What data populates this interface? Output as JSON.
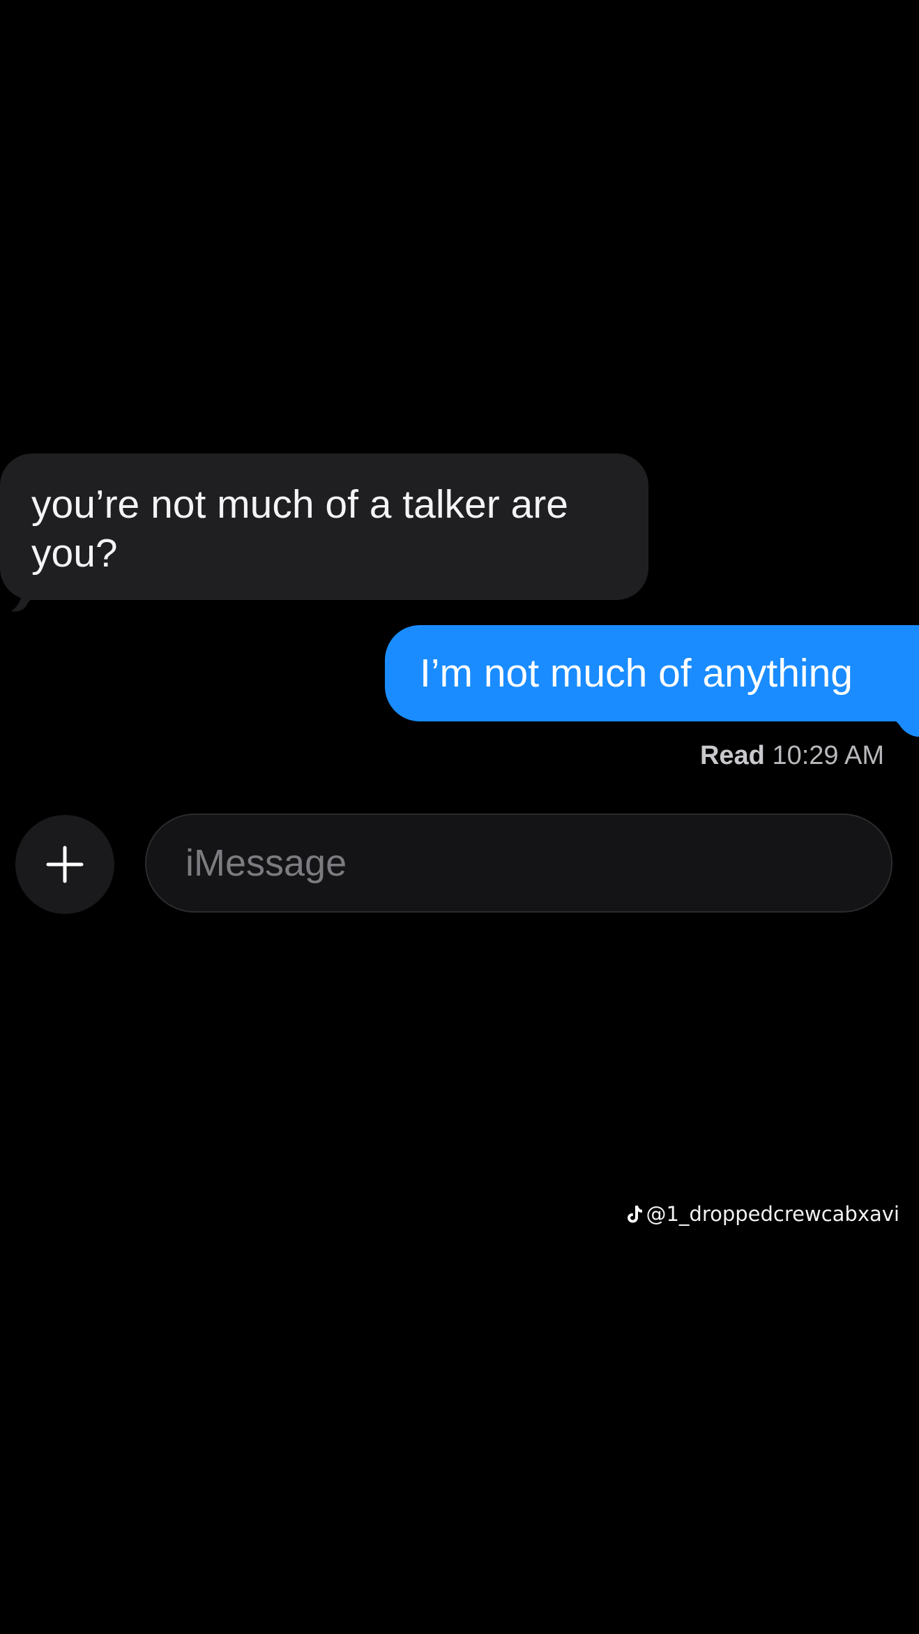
{
  "messages": {
    "received": {
      "text": "you’re not much of a talker are you?"
    },
    "sent": {
      "text": "I’m not much of anything"
    },
    "receipt": {
      "status": "Read",
      "time": "10:29 AM"
    }
  },
  "composer": {
    "placeholder": "iMessage",
    "add_icon": "plus-icon"
  },
  "watermark": {
    "handle": "@1_droppedcrewcabxavi",
    "logo_icon": "tiktok-icon"
  },
  "colors": {
    "background": "#000000",
    "received_bubble": "#1f1f21",
    "sent_bubble": "#1a8cff",
    "receipt_text": "#b9b9bd",
    "placeholder_text": "#7b7b80"
  }
}
